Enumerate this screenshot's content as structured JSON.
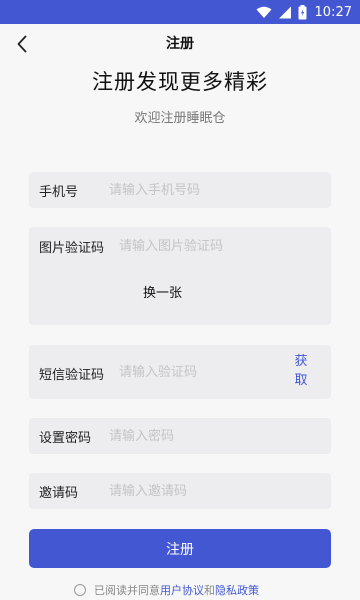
{
  "statusbar": {
    "time": "10:27",
    "icons": [
      "wifi-icon",
      "signal-icon",
      "battery-icon"
    ],
    "color": "#4357d2"
  },
  "nav": {
    "back_icon": "chevron-left-icon",
    "title": "注册"
  },
  "header": {
    "headline": "注册发现更多精彩",
    "subheadline": "欢迎注册睡眠仓"
  },
  "form": {
    "phone": {
      "label": "手机号",
      "placeholder": "请输入手机号码",
      "value": ""
    },
    "captcha": {
      "label": "图片验证码",
      "placeholder": "请输入图片验证码",
      "value": "",
      "refresh_label": "换一张"
    },
    "sms": {
      "label": "短信验证码",
      "placeholder": "请输入验证码",
      "value": "",
      "get_code_label": "获取"
    },
    "password": {
      "label": "设置密码",
      "placeholder": "请输入密码",
      "value": ""
    },
    "invite": {
      "label": "邀请码",
      "placeholder": "请输入邀请码",
      "value": ""
    },
    "submit_label": "注册"
  },
  "agreement": {
    "prefix": "已阅读并同意",
    "user_agreement": "用户协议",
    "and": "和",
    "privacy_policy": "隐私政策",
    "checked": false
  },
  "colors": {
    "accent": "#4357d2",
    "field_bg": "#ededf0",
    "page_bg": "#f7f7f8"
  }
}
